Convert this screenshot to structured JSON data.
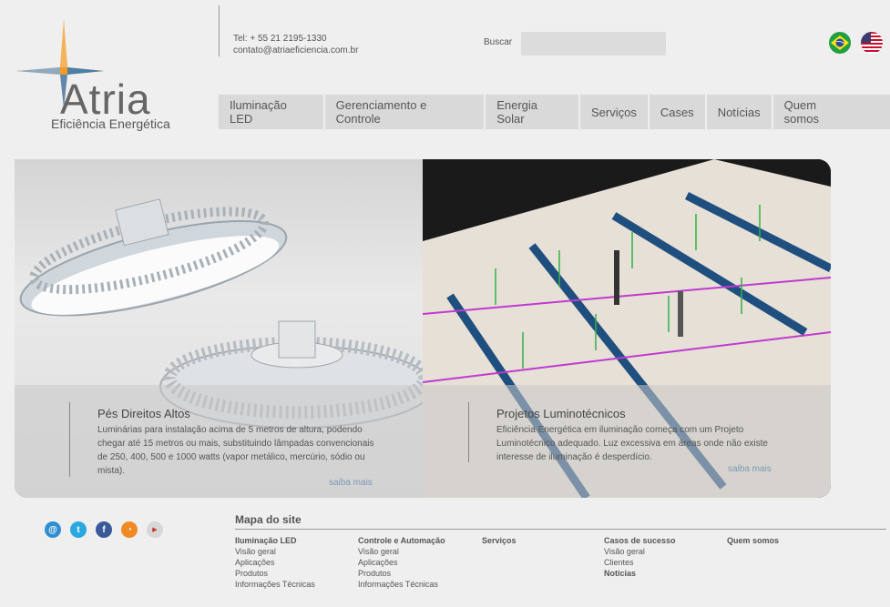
{
  "header": {
    "logo_text": "Atria",
    "logo_subtitle": "Eficiência Energética",
    "phone": "Tel: + 55 21 2195-1330",
    "email": "contato@atriaeficiencia.com.br",
    "search_label": "Buscar",
    "search_value": ""
  },
  "nav": {
    "items": [
      {
        "label": "Iluminação LED"
      },
      {
        "label": "Gerenciamento e Controle"
      },
      {
        "label": "Energia Solar"
      },
      {
        "label": "Serviços"
      },
      {
        "label": "Cases"
      },
      {
        "label": "Notícias"
      },
      {
        "label": "Quem somos"
      }
    ]
  },
  "banner": {
    "left": {
      "title": "Pés Direitos Altos",
      "text": "Luminárias para instalação acima de 5 metros de altura, podendo chegar até 15 metros ou mais, substituindo lâmpadas convencionais de 250, 400, 500 e 1000 watts (vapor metálico, mercúrio, sódio ou mista).",
      "more": "saiba mais"
    },
    "right": {
      "title": "Projetos Luminotécnicos",
      "text": "Eficiência Energética em iluminação começa com um Projeto Luminotécnico adequado. Luz excessiva em áreas onde não existe interesse de iluminação é desperdício.",
      "more": "saiba mais"
    }
  },
  "footer": {
    "sitemap_title": "Mapa do site",
    "columns": [
      {
        "head": "Iluminação LED",
        "links": [
          "Visão geral",
          "Aplicações",
          "Produtos",
          "Informações Técnicas"
        ]
      },
      {
        "head": "Controle e Automação",
        "links": [
          "Visão geral",
          "Aplicações",
          "Produtos",
          "Informações Técnicas"
        ]
      },
      {
        "head": "Serviços",
        "links": []
      },
      {
        "head": "Casos de sucesso",
        "links": [
          "Visão geral",
          "Clientes"
        ],
        "extra_bold": "Notícias"
      },
      {
        "head": "Quem somos",
        "links": []
      }
    ]
  },
  "icons": {
    "social": [
      "email-icon",
      "twitter-icon",
      "facebook-icon",
      "rss-icon",
      "youtube-icon"
    ]
  },
  "colors": {
    "logo_orange": "#f39a2a",
    "logo_blue": "#4a7fa6",
    "nav_bg": "#d9d9d9",
    "link_blue": "#7d97b5"
  }
}
